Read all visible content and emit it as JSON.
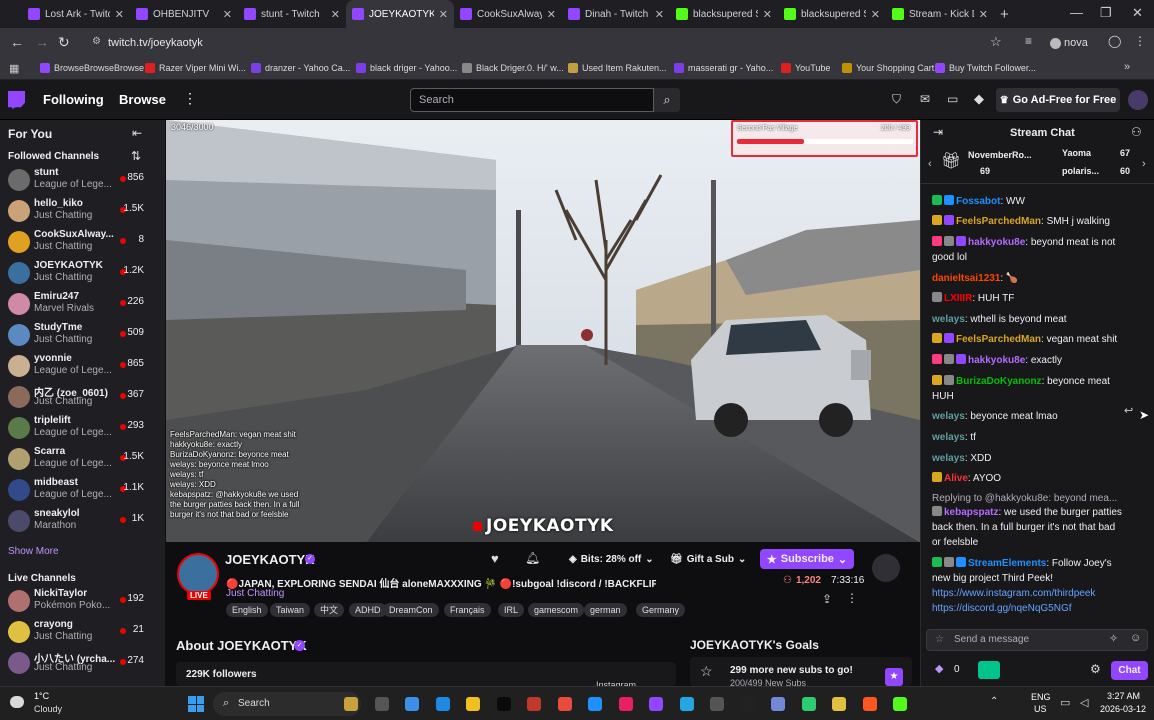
{
  "browser": {
    "tabs": [
      {
        "label": "Lost Ark - Twitch",
        "fav_color": "#9146ff"
      },
      {
        "label": "OHBENJITV",
        "fav_color": "#9146ff"
      },
      {
        "label": "stunt - Twitch",
        "fav_color": "#9146ff"
      },
      {
        "label": "JOEYKAOTYK",
        "fav_color": "#9146ff"
      },
      {
        "label": "CookSuxAlways",
        "fav_color": "#9146ff"
      },
      {
        "label": "Dinah - Twitch",
        "fav_color": "#9146ff"
      },
      {
        "label": "blacksupered Sh",
        "fav_color": "#53fc18"
      },
      {
        "label": "blacksupered Sh",
        "fav_color": "#53fc18"
      },
      {
        "label": "Stream - Kick D",
        "fav_color": "#53fc18"
      }
    ],
    "url": "twitch.tv/joeykaotyk",
    "profile": "nova",
    "bookmarks": [
      "BrowseBrowseBrowse",
      "Razer Viper Mini Wi...",
      "dranzer - Yahoo Ca...",
      "black driger - Yahoo...",
      "Black Driger.0. H/' w...",
      "Used Item Rakuten...",
      "masserati gr - Yaho...",
      "YouTube",
      "Your Shopping Cart",
      "Buy Twitch Follower..."
    ]
  },
  "topnav": {
    "following": "Following",
    "browse": "Browse",
    "search_placeholder": "Search",
    "ad_free": "Go Ad-Free for Free"
  },
  "sidebar": {
    "for_you": "For You",
    "followed_header": "Followed Channels",
    "followed": [
      {
        "name": "stunt",
        "game": "League of Lege...",
        "viewers": "856",
        "color": "#6b6b6b"
      },
      {
        "name": "hello_kiko",
        "game": "Just Chatting",
        "viewers": "1.5K",
        "color": "#c9a27a"
      },
      {
        "name": "CookSuxAlway...",
        "game": "Just Chatting",
        "viewers": "8",
        "color": "#e0a020"
      },
      {
        "name": "JOEYKAOTYK",
        "game": "Just Chatting",
        "viewers": "1.2K",
        "color": "#3a6f9e"
      },
      {
        "name": "Emiru247",
        "game": "Marvel Rivals",
        "viewers": "226",
        "color": "#d08aa8"
      },
      {
        "name": "StudyTme",
        "game": "Just Chatting",
        "viewers": "509",
        "color": "#5a8ac0"
      },
      {
        "name": "yvonnie",
        "game": "League of Lege...",
        "viewers": "865",
        "color": "#c8b090"
      },
      {
        "name": "内乙 (zoe_0601)",
        "game": "Just Chatting",
        "viewers": "367",
        "color": "#8a6a5a"
      },
      {
        "name": "triplelift",
        "game": "League of Lege...",
        "viewers": "293",
        "color": "#5a7a4a"
      },
      {
        "name": "Scarra",
        "game": "League of Lege...",
        "viewers": "1.5K",
        "color": "#b0a070"
      },
      {
        "name": "midbeast",
        "game": "League of Lege...",
        "viewers": "1.1K",
        "color": "#304a8a"
      },
      {
        "name": "sneakylol",
        "game": "Marathon",
        "viewers": "1K",
        "color": "#4a4a6a"
      }
    ],
    "show_more": "Show More",
    "live_header": "Live Channels",
    "live": [
      {
        "name": "NickiTaylor",
        "game": "Pokémon Poko...",
        "viewers": "192",
        "color": "#b07070"
      },
      {
        "name": "crayong",
        "game": "Just Chatting",
        "viewers": "21",
        "color": "#e0c040"
      },
      {
        "name": "小八たい (yrcha...",
        "game": "Just Chatting",
        "viewers": "274",
        "color": "#7a5a8a"
      }
    ]
  },
  "video": {
    "counter": "3046/3000",
    "subgoal_label": "Second Pas Village",
    "subgoal_count": "200 / 499",
    "subgoal_progress": 0.38,
    "watermark": "JOEYKAOTYK",
    "overlay_chat": [
      "FeelsParchedMan: vegan meat shit",
      "hakkyoku8e: exactly",
      "BurizaDoKyanonz: beyonce meat",
      "welays: beyonce meat lmoo",
      "welays: tf",
      "welays: XDD",
      "kebapspatz: @hakkyoku8e we used",
      "the burger patties back then. In a full",
      "burger it's not that bad or feelsble"
    ]
  },
  "channel": {
    "name": "JOEYKAOTYK",
    "title": "🔴JAPAN, EXPLORING SENDAI 仙台 aloneMAXXXING 🎋 🔴!subgoal !discord / !BACKFLIP🔴",
    "category": "Just Chatting",
    "live": "LIVE",
    "viewers": "1,202",
    "uptime": "7:33:16",
    "bits": "Bits: 28% off",
    "gift": "Gift a Sub",
    "subscribe": "Subscribe",
    "tags": [
      "English",
      "Taiwan",
      "中文",
      "ADHD",
      "DreamCon",
      "Français",
      "IRL",
      "gamescom",
      "german",
      "Germany"
    ],
    "about": "About JOEYKAOTYK",
    "followers": "229K followers",
    "instagram": "Instagram",
    "goals_title": "JOEYKAOTYK's Goals",
    "goal_text": "299 more new subs to go!",
    "goal_sub": "200/499 New Subs"
  },
  "chat": {
    "title": "Stream Chat",
    "gifters": [
      {
        "name": "NovemberRo...",
        "count": "69"
      },
      {
        "name": "Yaoma",
        "count": "67"
      },
      {
        "name": "polaris...",
        "count": "60"
      }
    ],
    "messages": [
      {
        "user": "Fossabot",
        "color": "#1e90ff",
        "text": ": WW"
      },
      {
        "user": "FeelsParchedMan",
        "color": "#daa520",
        "text": ": SMH j walking"
      },
      {
        "user": "hakkyoku8e",
        "color": "#b36cff",
        "text": ": beyond meat is not"
      },
      {
        "user": "",
        "color": "#efeff1",
        "text": "good lol"
      },
      {
        "user": "danieltsai1231",
        "color": "#ff4500",
        "text": ": 🍗"
      },
      {
        "user": "LXIIIR",
        "color": "#ff0000",
        "text": ": HUH TF"
      },
      {
        "user": "welays",
        "color": "#5f9ea0",
        "text": ": wthell is beyond meat"
      },
      {
        "user": "FeelsParchedMan",
        "color": "#daa520",
        "text": ": vegan meat shit"
      },
      {
        "user": "hakkyoku8e",
        "color": "#b36cff",
        "text": ": exactly"
      },
      {
        "user": "BurizaDoKyanonz",
        "color": "#00c000",
        "text": ": beyonce meat"
      },
      {
        "user": "",
        "color": "#efeff1",
        "text": "HUH"
      },
      {
        "user": "welays",
        "color": "#5f9ea0",
        "text": ": beyonce meat lmao"
      },
      {
        "user": "welays",
        "color": "#5f9ea0",
        "text": ": tf"
      },
      {
        "user": "welays",
        "color": "#5f9ea0",
        "text": ": XDD"
      },
      {
        "user": "Alive",
        "color": "#ff3030",
        "text": ": AYOO"
      },
      {
        "user": "",
        "color": "#adadb8",
        "text": "Replying to @hakkyoku8e: beyond mea..."
      },
      {
        "user": "kebapspatz",
        "color": "#b36cff",
        "text": ": we used the burger patties"
      },
      {
        "user": "",
        "color": "#efeff1",
        "text": "back then. In a full burger it's not that bad"
      },
      {
        "user": "",
        "color": "#efeff1",
        "text": "or feelsble"
      },
      {
        "user": "StreamElements",
        "color": "#1e90ff",
        "text": ": Follow Joey's"
      },
      {
        "user": "",
        "color": "#efeff1",
        "text": "new big project Third Peek!"
      },
      {
        "user": "",
        "color": "#66a3ff",
        "text": "https://www.instagram.com/thirdpeek"
      },
      {
        "user": "",
        "color": "#66a3ff",
        "text": "https://discord.gg/nqeNqG5NGf"
      }
    ],
    "placeholder": "Send a message",
    "points": "0",
    "chat_button": "Chat"
  },
  "taskbar": {
    "weather_temp": "1°C",
    "weather": "Cloudy",
    "search": "Search",
    "lang": "ENG",
    "region": "US",
    "time": "3:27 AM",
    "date": "2026-03-12"
  }
}
